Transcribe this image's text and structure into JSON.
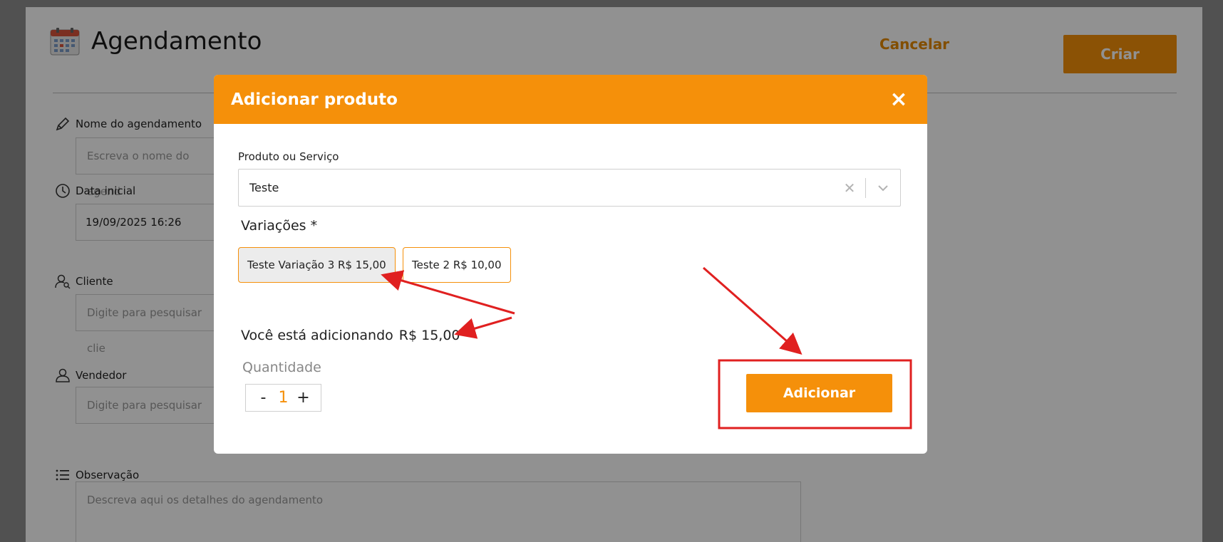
{
  "page": {
    "title": "Agendamento",
    "cancel_label": "Cancelar",
    "create_label": "Criar",
    "fields": {
      "name_label": "Nome do agendamento",
      "name_placeholder": "Escreva o nome do agend",
      "date_label": "Data inicial",
      "date_value": "19/09/2025 16:26",
      "client_label": "Cliente",
      "client_placeholder": "Digite para pesquisar clie",
      "seller_label": "Vendedor",
      "seller_placeholder": "Digite para pesquisar",
      "notes_label": "Observação",
      "notes_placeholder": "Descreva aqui os detalhes do agendamento"
    }
  },
  "modal": {
    "title": "Adicionar produto",
    "close_icon": "×",
    "product_label": "Produto ou Serviço",
    "product_value": "Teste",
    "variations_label": "Variações *",
    "variations": [
      {
        "label": "Teste Variação 3 R$ 15,00",
        "selected": true
      },
      {
        "label": "Teste 2 R$ 10,00",
        "selected": false
      }
    ],
    "adding_prefix": "Você está adicionando",
    "adding_price": "R$ 15,00",
    "quantity_label": "Quantidade",
    "quantity_minus": "-",
    "quantity_value": "1",
    "quantity_plus": "+",
    "add_label": "Adicionar"
  },
  "colors": {
    "accent": "#f5900a",
    "annotation": "#e02020"
  }
}
